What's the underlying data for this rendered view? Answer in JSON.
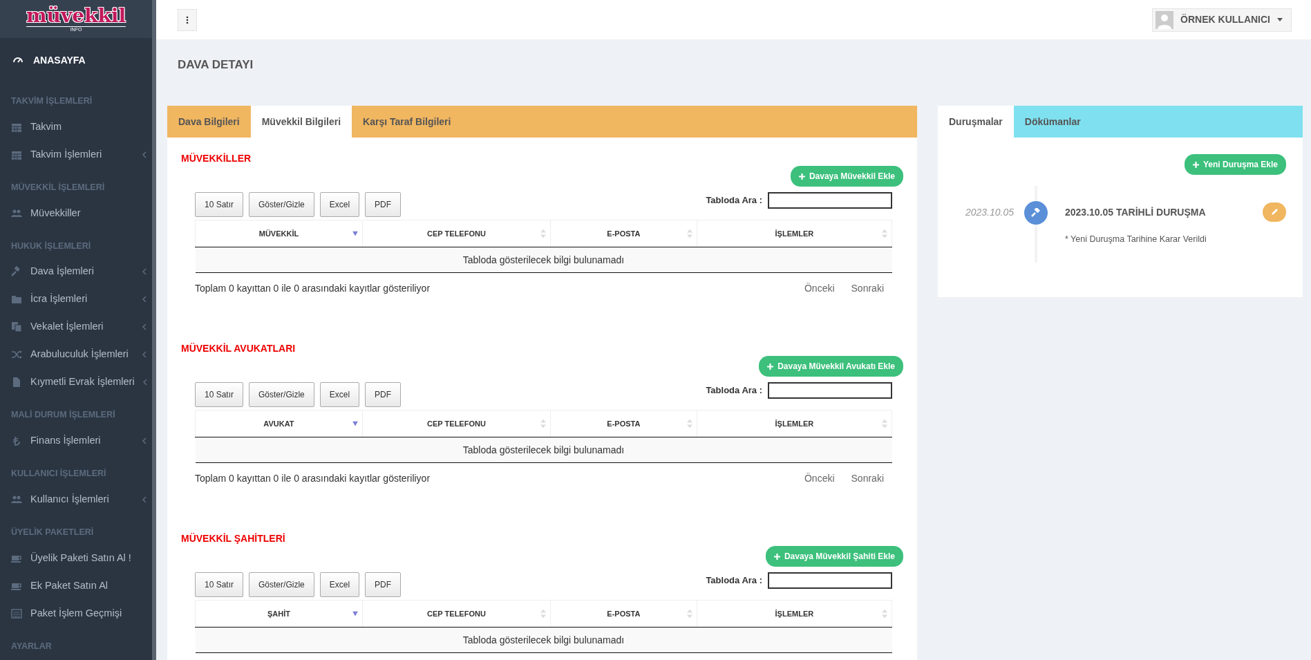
{
  "logo": {
    "text": "müvekkil",
    "subtext": "INFO"
  },
  "sidebar": {
    "items": [
      {
        "kind": "home",
        "label": "ANASAYFA",
        "has_submenu": false
      },
      {
        "kind": "heading",
        "label": "TAKVİM İŞLEMLERİ"
      },
      {
        "kind": "item",
        "label": "Takvim",
        "has_submenu": false
      },
      {
        "kind": "item",
        "label": "Takvim İşlemleri",
        "has_submenu": true
      },
      {
        "kind": "heading",
        "label": "MÜVEKKİL İŞLEMLERİ"
      },
      {
        "kind": "item",
        "label": "Müvekkiller",
        "has_submenu": false
      },
      {
        "kind": "heading",
        "label": "HUKUK İŞLEMLERİ"
      },
      {
        "kind": "item",
        "label": "Dava İşlemleri",
        "has_submenu": true
      },
      {
        "kind": "item",
        "label": "İcra İşlemleri",
        "has_submenu": true
      },
      {
        "kind": "item",
        "label": "Vekalet İşlemleri",
        "has_submenu": true
      },
      {
        "kind": "item",
        "label": "Arabuluculuk İşlemleri",
        "has_submenu": true
      },
      {
        "kind": "item",
        "label": "Kıymetli Evrak İşlemleri",
        "has_submenu": true
      },
      {
        "kind": "heading",
        "label": "MALİ DURUM İŞLEMLERİ"
      },
      {
        "kind": "item",
        "label": "Finans İşlemleri",
        "has_submenu": true
      },
      {
        "kind": "heading",
        "label": "KULLANICI İŞLEMLERİ"
      },
      {
        "kind": "item",
        "label": "Kullanıcı İşlemleri",
        "has_submenu": true
      },
      {
        "kind": "heading",
        "label": "ÜYELİK PAKETLERİ"
      },
      {
        "kind": "item",
        "label": "Üyelik Paketi Satın Al !",
        "has_submenu": false
      },
      {
        "kind": "item",
        "label": "Ek Paket Satın Al",
        "has_submenu": false
      },
      {
        "kind": "item",
        "label": "Paket İşlem Geçmişi",
        "has_submenu": false
      },
      {
        "kind": "heading",
        "label": "AYARLAR"
      }
    ]
  },
  "topbar": {
    "user": "ÖRNEK KULLANICI"
  },
  "page_title": "DAVA DETAYI",
  "main_panel": {
    "tabs": [
      {
        "label": "Dava Bilgileri",
        "selected": false
      },
      {
        "label": "Müvekkil Bilgileri",
        "selected": true
      },
      {
        "label": "Karşı Taraf Bilgileri",
        "selected": false
      }
    ],
    "sections": [
      {
        "title": "MÜVEKKİLLER",
        "add_button": "Davaya Müvekkil Ekle",
        "tools": [
          "10 Satır",
          "Göster/Gizle",
          "Excel",
          "PDF"
        ],
        "search_label": "Tabloda Ara :",
        "columns": [
          {
            "label": "MÜVEKKİL",
            "sorted_descending": true
          },
          {
            "label": "CEP TELEFONU",
            "sorted_descending": false
          },
          {
            "label": "E-POSTA",
            "sorted_descending": false
          },
          {
            "label": "İŞLEMLER",
            "sorted_descending": false
          }
        ],
        "empty_text": "Tabloda gösterilecek bilgi bulunamadı",
        "info": "Toplam 0 kayıttan 0 ile 0 arasındaki kayıtlar gösteriliyor",
        "pager": [
          "Önceki",
          "Sonraki"
        ]
      },
      {
        "title": "MÜVEKKİL AVUKATLARI",
        "add_button": "Davaya Müvekkil Avukatı Ekle",
        "tools": [
          "10 Satır",
          "Göster/Gizle",
          "Excel",
          "PDF"
        ],
        "search_label": "Tabloda Ara :",
        "columns": [
          {
            "label": "AVUKAT",
            "sorted_descending": true
          },
          {
            "label": "CEP TELEFONU",
            "sorted_descending": false
          },
          {
            "label": "E-POSTA",
            "sorted_descending": false
          },
          {
            "label": "İŞLEMLER",
            "sorted_descending": false
          }
        ],
        "empty_text": "Tabloda gösterilecek bilgi bulunamadı",
        "info": "Toplam 0 kayıttan 0 ile 0 arasındaki kayıtlar gösteriliyor",
        "pager": [
          "Önceki",
          "Sonraki"
        ]
      },
      {
        "title": "MÜVEKKİL ŞAHİTLERİ",
        "add_button": "Davaya Müvekkil Şahiti Ekle",
        "tools": [
          "10 Satır",
          "Göster/Gizle",
          "Excel",
          "PDF"
        ],
        "search_label": "Tabloda Ara :",
        "columns": [
          {
            "label": "ŞAHİT",
            "sorted_descending": true
          },
          {
            "label": "CEP TELEFONU",
            "sorted_descending": false
          },
          {
            "label": "E-POSTA",
            "sorted_descending": false
          },
          {
            "label": "İŞLEMLER",
            "sorted_descending": false
          }
        ],
        "empty_text": "Tabloda gösterilecek bilgi bulunamadı"
      }
    ]
  },
  "side_panel": {
    "tabs": [
      {
        "label": "Duruşmalar",
        "selected": true
      },
      {
        "label": "Dökümanlar",
        "selected": false
      }
    ],
    "add_button": "Yeni Duruşma Ekle",
    "timeline": [
      {
        "date": "2023.10.05",
        "title": "2023.10.05 TARİHLİ DURUŞMA",
        "note": "* Yeni Duruşma Tarihine Karar Verildi"
      }
    ]
  }
}
